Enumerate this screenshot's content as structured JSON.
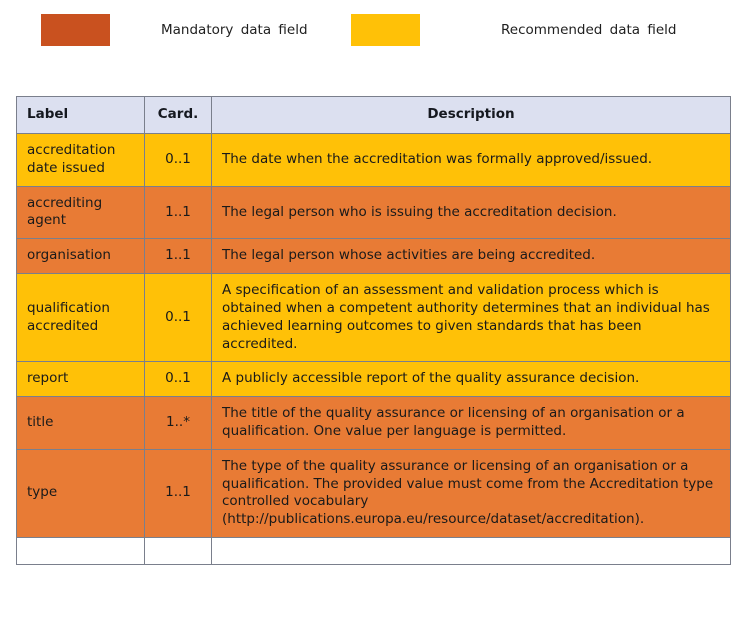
{
  "legend": {
    "items": [
      {
        "key": "mandatory",
        "label": "Mandatory data field",
        "color": "#c9511f"
      },
      {
        "key": "recommended",
        "label": "Recommended data field",
        "color": "#ffc107"
      }
    ]
  },
  "table": {
    "columns": {
      "label": "Label",
      "cardinality": "Card.",
      "description": "Description"
    },
    "row_colors": {
      "mandatory": "#e87b35",
      "recommended": "#ffc107",
      "header": "#dce0f0",
      "border": "#7a7f8c"
    },
    "rows": [
      {
        "label": "accreditation date issued",
        "cardinality": "0..1",
        "description": "The date when the accreditation was formally approved/issued.",
        "kind": "recommended"
      },
      {
        "label": "accrediting agent",
        "cardinality": "1..1",
        "description": "The legal person who is issuing the accreditation decision.",
        "kind": "mandatory"
      },
      {
        "label": "organisation",
        "cardinality": "1..1",
        "description": "The legal person whose activities are being accredited.",
        "kind": "mandatory"
      },
      {
        "label": "qualification accredited",
        "cardinality": "0..1",
        "description": "A specification of an assessment and validation process which is obtained when a competent authority determines that an individual has achieved learning outcomes to given standards that has been accredited.",
        "kind": "recommended"
      },
      {
        "label": "report",
        "cardinality": "0..1",
        "description": "A publicly accessible report of the quality assurance decision.",
        "kind": "recommended"
      },
      {
        "label": "title",
        "cardinality": "1..*",
        "description": "The title of the quality assurance or licensing of an organisation or a qualification. One value per language is permitted.",
        "kind": "mandatory"
      },
      {
        "label": "type",
        "cardinality": "1..1",
        "description": "The type of the quality assurance or licensing of an organisation or a qualification. The provided value must come from the Accreditation type controlled vocabulary (http://publications.europa.eu/resource/dataset/accreditation).",
        "kind": "mandatory"
      }
    ]
  }
}
